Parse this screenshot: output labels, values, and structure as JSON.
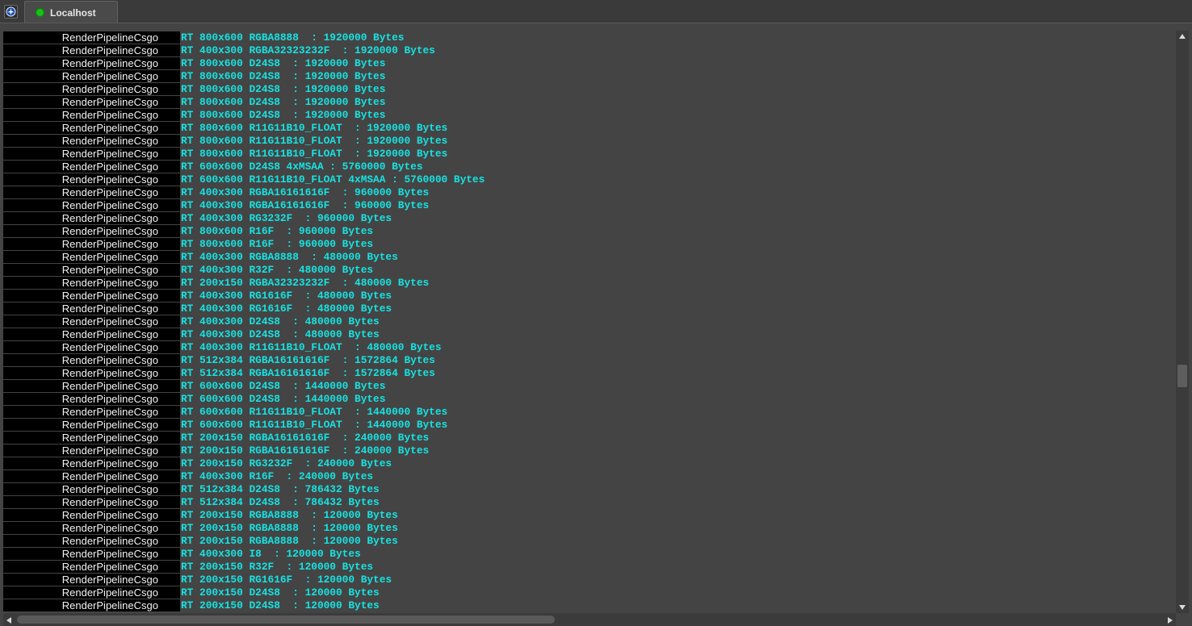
{
  "tabs": [
    {
      "label": "Localhost",
      "status_color": "#18c118",
      "icon": "status-dot-icon"
    }
  ],
  "toolbar": {
    "add_icon": "plus-circle-icon"
  },
  "log": {
    "source_color": "#f2f2f2",
    "message_color": "#17e2e2",
    "rows": [
      {
        "source": "RenderPipelineCsgo",
        "message": "RT 800x600 RGBA8888  : 1920000 Bytes"
      },
      {
        "source": "RenderPipelineCsgo",
        "message": "RT 400x300 RGBA32323232F  : 1920000 Bytes"
      },
      {
        "source": "RenderPipelineCsgo",
        "message": "RT 800x600 D24S8  : 1920000 Bytes"
      },
      {
        "source": "RenderPipelineCsgo",
        "message": "RT 800x600 D24S8  : 1920000 Bytes"
      },
      {
        "source": "RenderPipelineCsgo",
        "message": "RT 800x600 D24S8  : 1920000 Bytes"
      },
      {
        "source": "RenderPipelineCsgo",
        "message": "RT 800x600 D24S8  : 1920000 Bytes"
      },
      {
        "source": "RenderPipelineCsgo",
        "message": "RT 800x600 D24S8  : 1920000 Bytes"
      },
      {
        "source": "RenderPipelineCsgo",
        "message": "RT 800x600 R11G11B10_FLOAT  : 1920000 Bytes"
      },
      {
        "source": "RenderPipelineCsgo",
        "message": "RT 800x600 R11G11B10_FLOAT  : 1920000 Bytes"
      },
      {
        "source": "RenderPipelineCsgo",
        "message": "RT 800x600 R11G11B10_FLOAT  : 1920000 Bytes"
      },
      {
        "source": "RenderPipelineCsgo",
        "message": "RT 600x600 D24S8 4xMSAA : 5760000 Bytes"
      },
      {
        "source": "RenderPipelineCsgo",
        "message": "RT 600x600 R11G11B10_FLOAT 4xMSAA : 5760000 Bytes"
      },
      {
        "source": "RenderPipelineCsgo",
        "message": "RT 400x300 RGBA16161616F  : 960000 Bytes"
      },
      {
        "source": "RenderPipelineCsgo",
        "message": "RT 400x300 RGBA16161616F  : 960000 Bytes"
      },
      {
        "source": "RenderPipelineCsgo",
        "message": "RT 400x300 RG3232F  : 960000 Bytes"
      },
      {
        "source": "RenderPipelineCsgo",
        "message": "RT 800x600 R16F  : 960000 Bytes"
      },
      {
        "source": "RenderPipelineCsgo",
        "message": "RT 800x600 R16F  : 960000 Bytes"
      },
      {
        "source": "RenderPipelineCsgo",
        "message": "RT 400x300 RGBA8888  : 480000 Bytes"
      },
      {
        "source": "RenderPipelineCsgo",
        "message": "RT 400x300 R32F  : 480000 Bytes"
      },
      {
        "source": "RenderPipelineCsgo",
        "message": "RT 200x150 RGBA32323232F  : 480000 Bytes"
      },
      {
        "source": "RenderPipelineCsgo",
        "message": "RT 400x300 RG1616F  : 480000 Bytes"
      },
      {
        "source": "RenderPipelineCsgo",
        "message": "RT 400x300 RG1616F  : 480000 Bytes"
      },
      {
        "source": "RenderPipelineCsgo",
        "message": "RT 400x300 D24S8  : 480000 Bytes"
      },
      {
        "source": "RenderPipelineCsgo",
        "message": "RT 400x300 D24S8  : 480000 Bytes"
      },
      {
        "source": "RenderPipelineCsgo",
        "message": "RT 400x300 R11G11B10_FLOAT  : 480000 Bytes"
      },
      {
        "source": "RenderPipelineCsgo",
        "message": "RT 512x384 RGBA16161616F  : 1572864 Bytes"
      },
      {
        "source": "RenderPipelineCsgo",
        "message": "RT 512x384 RGBA16161616F  : 1572864 Bytes"
      },
      {
        "source": "RenderPipelineCsgo",
        "message": "RT 600x600 D24S8  : 1440000 Bytes"
      },
      {
        "source": "RenderPipelineCsgo",
        "message": "RT 600x600 D24S8  : 1440000 Bytes"
      },
      {
        "source": "RenderPipelineCsgo",
        "message": "RT 600x600 R11G11B10_FLOAT  : 1440000 Bytes"
      },
      {
        "source": "RenderPipelineCsgo",
        "message": "RT 600x600 R11G11B10_FLOAT  : 1440000 Bytes"
      },
      {
        "source": "RenderPipelineCsgo",
        "message": "RT 200x150 RGBA16161616F  : 240000 Bytes"
      },
      {
        "source": "RenderPipelineCsgo",
        "message": "RT 200x150 RGBA16161616F  : 240000 Bytes"
      },
      {
        "source": "RenderPipelineCsgo",
        "message": "RT 200x150 RG3232F  : 240000 Bytes"
      },
      {
        "source": "RenderPipelineCsgo",
        "message": "RT 400x300 R16F  : 240000 Bytes"
      },
      {
        "source": "RenderPipelineCsgo",
        "message": "RT 512x384 D24S8  : 786432 Bytes"
      },
      {
        "source": "RenderPipelineCsgo",
        "message": "RT 512x384 D24S8  : 786432 Bytes"
      },
      {
        "source": "RenderPipelineCsgo",
        "message": "RT 200x150 RGBA8888  : 120000 Bytes"
      },
      {
        "source": "RenderPipelineCsgo",
        "message": "RT 200x150 RGBA8888  : 120000 Bytes"
      },
      {
        "source": "RenderPipelineCsgo",
        "message": "RT 200x150 RGBA8888  : 120000 Bytes"
      },
      {
        "source": "RenderPipelineCsgo",
        "message": "RT 400x300 I8  : 120000 Bytes"
      },
      {
        "source": "RenderPipelineCsgo",
        "message": "RT 200x150 R32F  : 120000 Bytes"
      },
      {
        "source": "RenderPipelineCsgo",
        "message": "RT 200x150 RG1616F  : 120000 Bytes"
      },
      {
        "source": "RenderPipelineCsgo",
        "message": "RT 200x150 D24S8  : 120000 Bytes"
      },
      {
        "source": "RenderPipelineCsgo",
        "message": "RT 200x150 D24S8  : 120000 Bytes"
      }
    ]
  },
  "scrollbars": {
    "vertical_position": 0.6,
    "horizontal_position": 0.0,
    "horizontal_visible_fraction": 0.47
  }
}
